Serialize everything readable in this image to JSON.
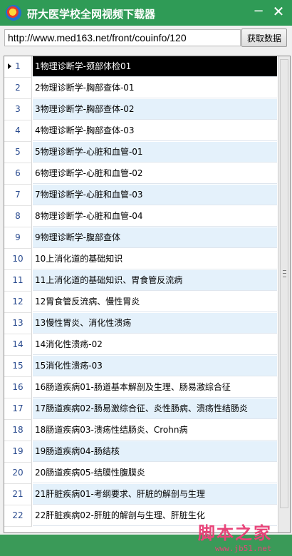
{
  "window": {
    "title": "研大医学校全网视频下载器"
  },
  "titlebar": {
    "minimize_glyph": "−",
    "close_glyph": "✕"
  },
  "toolbar": {
    "url_value": "http://www.med163.net/front/couinfo/120",
    "fetch_label": "获取数据"
  },
  "grid": {
    "selected_index": 0,
    "rows": [
      {
        "num": "1",
        "title": "1物理诊断学-颈部体检01"
      },
      {
        "num": "2",
        "title": "2物理诊断学-胸部查体-01"
      },
      {
        "num": "3",
        "title": "3物理诊断学-胸部查体-02"
      },
      {
        "num": "4",
        "title": "4物理诊断学-胸部查体-03"
      },
      {
        "num": "5",
        "title": "5物理诊断学-心脏和血管-01"
      },
      {
        "num": "6",
        "title": "6物理诊断学-心脏和血管-02"
      },
      {
        "num": "7",
        "title": "7物理诊断学-心脏和血管-03"
      },
      {
        "num": "8",
        "title": "8物理诊断学-心脏和血管-04"
      },
      {
        "num": "9",
        "title": "9物理诊断学-腹部查体"
      },
      {
        "num": "10",
        "title": "10上消化道的基础知识"
      },
      {
        "num": "11",
        "title": "11上消化道的基础知识、胃食管反流病"
      },
      {
        "num": "12",
        "title": "12胃食管反流病、慢性胃炎"
      },
      {
        "num": "13",
        "title": "13慢性胃炎、消化性溃疡"
      },
      {
        "num": "14",
        "title": "14消化性溃疡-02"
      },
      {
        "num": "15",
        "title": "15消化性溃疡-03"
      },
      {
        "num": "16",
        "title": "16肠道疾病01-肠道基本解剖及生理、肠易激综合征"
      },
      {
        "num": "17",
        "title": "17肠道疾病02-肠易激综合征、炎性肠病、溃疡性结肠炎"
      },
      {
        "num": "18",
        "title": "18肠道疾病03-溃疡性结肠炎、Crohn病"
      },
      {
        "num": "19",
        "title": "19肠道疾病04-肠结核"
      },
      {
        "num": "20",
        "title": "20肠道疾病05-结膜性腹膜炎"
      },
      {
        "num": "21",
        "title": "21肝脏疾病01-考纲要求、肝脏的解剖与生理"
      },
      {
        "num": "22",
        "title": "22肝脏疾病02-肝脏的解剖与生理、肝脏生化"
      }
    ]
  },
  "watermark": {
    "main": "脚本之家",
    "sub": "www.jb51.net"
  }
}
